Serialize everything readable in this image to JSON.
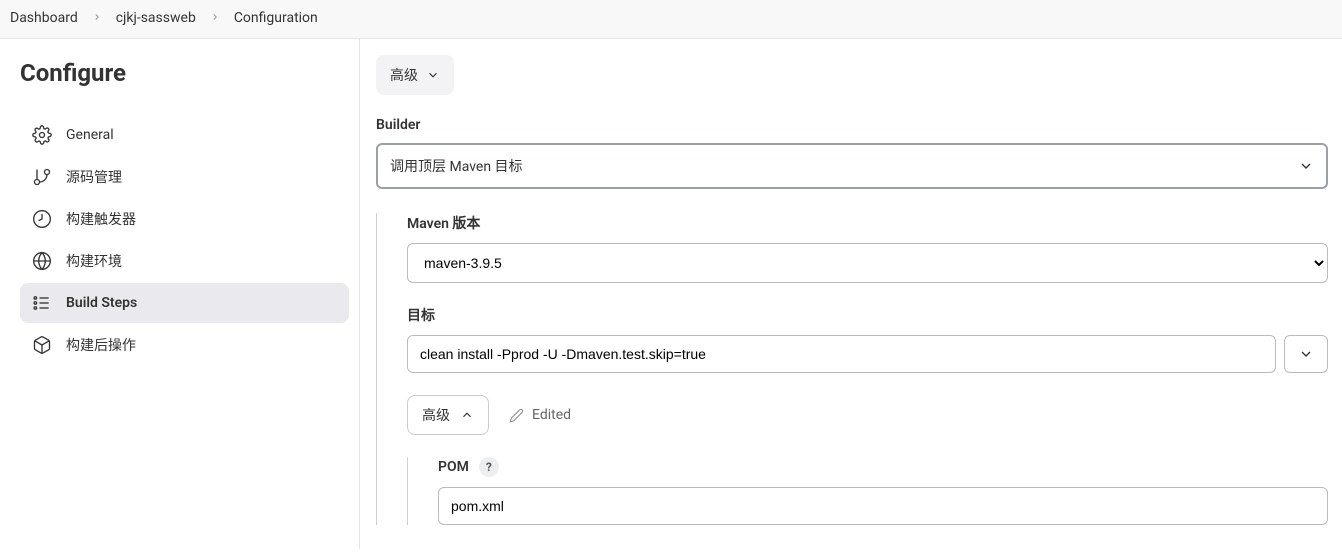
{
  "breadcrumb": {
    "items": [
      "Dashboard",
      "cjkj-sassweb",
      "Configuration"
    ]
  },
  "sidebar": {
    "title": "Configure",
    "items": [
      {
        "label": "General"
      },
      {
        "label": "源码管理"
      },
      {
        "label": "构建触发器"
      },
      {
        "label": "构建环境"
      },
      {
        "label": "Build Steps"
      },
      {
        "label": "构建后操作"
      }
    ],
    "active_index": 4
  },
  "content": {
    "top_advanced_label": "高级",
    "builder_title": "Builder",
    "builder_selected": "调用顶层 Maven 目标",
    "maven": {
      "version_label": "Maven 版本",
      "version_value": "maven-3.9.5",
      "version_options": [
        "maven-3.9.5"
      ],
      "goals_label": "目标",
      "goals_value": "clean install -Pprod -U -Dmaven.test.skip=true",
      "advanced_label": "高级",
      "edited_label": "Edited",
      "pom_label": "POM",
      "pom_value": "pom.xml",
      "pom_help": "?"
    }
  }
}
